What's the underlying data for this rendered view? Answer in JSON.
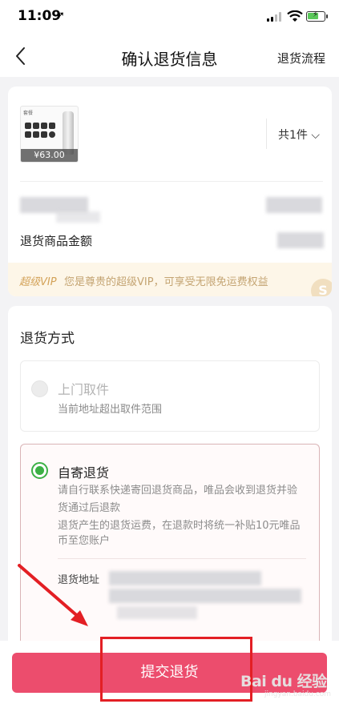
{
  "status_bar": {
    "time": "11:09",
    "location_arrow": "➚"
  },
  "nav": {
    "title": "确认退货信息",
    "right_link": "退货流程"
  },
  "product": {
    "thumb_tag": "套餐",
    "price": "¥63.00",
    "quantity": "共1件 ⌵",
    "amount_label": "退货商品金额"
  },
  "vip": {
    "tag": "超级VIP",
    "text": "您是尊贵的超级VIP，可享受无限免运费权益",
    "badge": "S"
  },
  "return_method": {
    "title": "退货方式",
    "pickup": {
      "title": "上门取件",
      "subtitle": "当前地址超出取件范围",
      "selected": false
    },
    "mail": {
      "title": "自寄退货",
      "selected": true,
      "desc_line1": "请自行联系快递寄回退货商品，唯品会收到退货并验",
      "desc_line2": "货通过后退款",
      "desc_line3": "退货产生的退货运费，在退款时将统一补贴10元唯品",
      "desc_line4": "币至您账户",
      "address_label": "退货地址"
    }
  },
  "submit": {
    "label": "提交退货"
  },
  "watermark": {
    "text": "Bai du 经验",
    "sub": "jingyan.baidu.com"
  },
  "colors": {
    "accent": "#ec4d6d",
    "selected_green": "#3cb045",
    "vip_gold": "#d3a258",
    "annotation_red": "#e31f24"
  }
}
